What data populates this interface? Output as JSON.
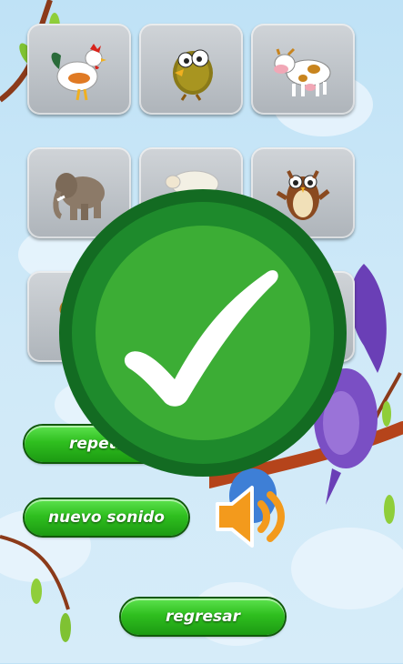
{
  "tiles": [
    {
      "animal": "rooster"
    },
    {
      "animal": "chick"
    },
    {
      "animal": "cow"
    },
    {
      "animal": "elephant"
    },
    {
      "animal": "sheep"
    },
    {
      "animal": "owl"
    },
    {
      "animal": "horse"
    }
  ],
  "buttons": {
    "repeat_label": "repetir s",
    "new_sound_label": "nuevo sonido",
    "back_label": "regresar"
  },
  "overlay": {
    "icon": "checkmark-icon",
    "color": "#1e8a2c"
  },
  "colors": {
    "button_green": "#2fbf1f",
    "speaker_orange": "#f39a1c",
    "parrot_purple": "#7a4fc4"
  }
}
